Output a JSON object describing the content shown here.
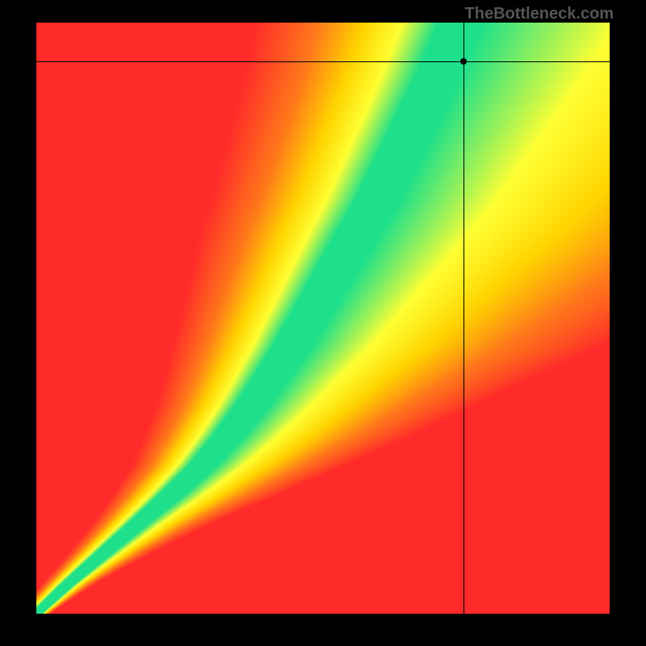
{
  "watermark": "TheBottleneck.com",
  "chart_data": {
    "type": "heatmap",
    "title": "",
    "xlabel": "",
    "ylabel": "",
    "xlim": [
      0,
      1
    ],
    "ylim": [
      0,
      1
    ],
    "crosshair": {
      "x": 0.745,
      "y": 0.935
    },
    "colorscale": [
      "#ff2a2a",
      "#ff7a1a",
      "#ffd400",
      "#ffff33",
      "#1ee08a"
    ],
    "ridge_description": "Green optimal ridge curves from lower-left corner upward; starts steep, bends, then rises near-linearly toward upper-middle. Away from ridge value falls through yellow/orange to red.",
    "ridge_samples": [
      {
        "y": 0.0,
        "x": 0.0,
        "halfwidth": 0.01
      },
      {
        "y": 0.05,
        "x": 0.055,
        "halfwidth": 0.012
      },
      {
        "y": 0.1,
        "x": 0.115,
        "halfwidth": 0.015
      },
      {
        "y": 0.15,
        "x": 0.175,
        "halfwidth": 0.018
      },
      {
        "y": 0.2,
        "x": 0.235,
        "halfwidth": 0.022
      },
      {
        "y": 0.25,
        "x": 0.29,
        "halfwidth": 0.025
      },
      {
        "y": 0.3,
        "x": 0.335,
        "halfwidth": 0.028
      },
      {
        "y": 0.35,
        "x": 0.375,
        "halfwidth": 0.03
      },
      {
        "y": 0.4,
        "x": 0.41,
        "halfwidth": 0.032
      },
      {
        "y": 0.45,
        "x": 0.445,
        "halfwidth": 0.034
      },
      {
        "y": 0.5,
        "x": 0.475,
        "halfwidth": 0.035
      },
      {
        "y": 0.55,
        "x": 0.505,
        "halfwidth": 0.036
      },
      {
        "y": 0.6,
        "x": 0.535,
        "halfwidth": 0.037
      },
      {
        "y": 0.65,
        "x": 0.565,
        "halfwidth": 0.038
      },
      {
        "y": 0.7,
        "x": 0.595,
        "halfwidth": 0.038
      },
      {
        "y": 0.75,
        "x": 0.62,
        "halfwidth": 0.038
      },
      {
        "y": 0.8,
        "x": 0.645,
        "halfwidth": 0.038
      },
      {
        "y": 0.85,
        "x": 0.67,
        "halfwidth": 0.038
      },
      {
        "y": 0.9,
        "x": 0.695,
        "halfwidth": 0.038
      },
      {
        "y": 0.95,
        "x": 0.718,
        "halfwidth": 0.038
      },
      {
        "y": 1.0,
        "x": 0.74,
        "halfwidth": 0.038
      }
    ]
  }
}
